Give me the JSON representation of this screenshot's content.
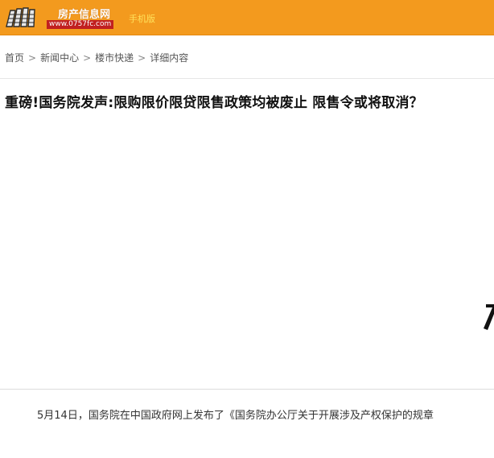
{
  "header": {
    "logo_title": "房产信息网",
    "logo_url": "www.0757fc.com",
    "mobile_link": "手机版",
    "bar_color": "#f39a1e",
    "mobile_link_color": "#ffe15a"
  },
  "breadcrumb": {
    "items": [
      "首页",
      "新闻中心",
      "楼市快递",
      "详细内容"
    ],
    "separator": ">"
  },
  "article": {
    "title": "重磅!国务院发声:限购限价限贷限售政策均被废止 限售令或将取消？",
    "body_first_line": "5月14日，国务院在中国政府网上发布了《国务院办公厅关于开展涉及产权保护的规章"
  },
  "banner": {
    "star_color": "#c8102e"
  }
}
